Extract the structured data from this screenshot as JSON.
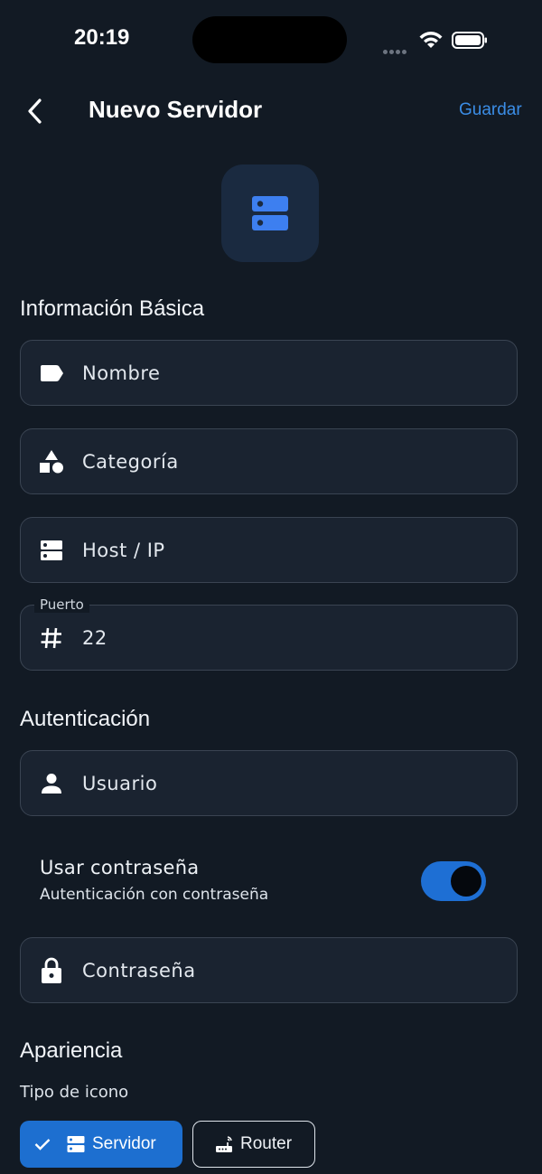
{
  "status_bar": {
    "time": "20:19"
  },
  "header": {
    "title": "Nuevo Servidor",
    "save_label": "Guardar"
  },
  "basic_info": {
    "section_title": "Información Básica",
    "name_placeholder": "Nombre",
    "category_placeholder": "Categoría",
    "host_placeholder": "Host / IP",
    "port_label": "Puerto",
    "port_value": "22"
  },
  "auth": {
    "section_title": "Autenticación",
    "user_placeholder": "Usuario",
    "use_password_title": "Usar contraseña",
    "use_password_subtitle": "Autenticación con contraseña",
    "use_password_enabled": true,
    "password_placeholder": "Contraseña"
  },
  "appearance": {
    "section_title": "Apariencia",
    "icon_type_label": "Tipo de icono",
    "options": [
      {
        "label": "Servidor",
        "selected": true,
        "icon": "server-icon"
      },
      {
        "label": "Router",
        "selected": false,
        "icon": "router-icon"
      }
    ]
  },
  "colors": {
    "accent": "#1d6fd0",
    "link": "#3b8de6",
    "background": "#121a24",
    "field": "#1a2330"
  }
}
